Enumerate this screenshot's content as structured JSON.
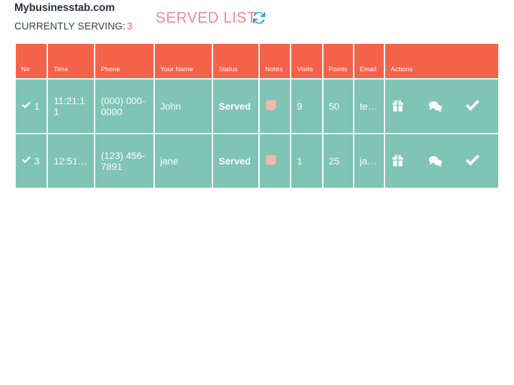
{
  "header": {
    "brand": "Mybusinesstab.com",
    "serving_label": "CURRENTLY SERVING:",
    "serving_number": "3",
    "page_title": "SERVED LIST",
    "refresh_icon": "refresh-icon",
    "accent_coral": "#f4624a",
    "accent_pink": "#f2899a",
    "accent_teal": "#7fc4b4",
    "refresh_blue": "#1f9bd8"
  },
  "table": {
    "columns": [
      {
        "key": "no",
        "label": "No"
      },
      {
        "key": "time",
        "label": "Time"
      },
      {
        "key": "phone",
        "label": "Phone"
      },
      {
        "key": "name",
        "label": "Your Name"
      },
      {
        "key": "status",
        "label": "Status"
      },
      {
        "key": "notes",
        "label": "Notes"
      },
      {
        "key": "visits",
        "label": "Visits"
      },
      {
        "key": "points",
        "label": "Points"
      },
      {
        "key": "email",
        "label": "Email"
      },
      {
        "key": "actions",
        "label": "Actions"
      }
    ],
    "rows": [
      {
        "no": "1",
        "time": "11:21:11",
        "phone": "(000) 000-0000",
        "name": "John",
        "status": "Served",
        "notes_icon": "sticky-note-icon",
        "visits": "9",
        "points": "50",
        "email": "te…",
        "actions": [
          "gift-icon",
          "chat-bubbles-icon",
          "check-icon"
        ]
      },
      {
        "no": "3",
        "time": "12:51…",
        "phone": "(123) 456-7891",
        "name": "jane",
        "status": "Served",
        "notes_icon": "sticky-note-icon",
        "visits": "1",
        "points": "25",
        "email": "ja…",
        "actions": [
          "gift-icon",
          "chat-bubbles-icon",
          "check-icon"
        ]
      }
    ]
  }
}
